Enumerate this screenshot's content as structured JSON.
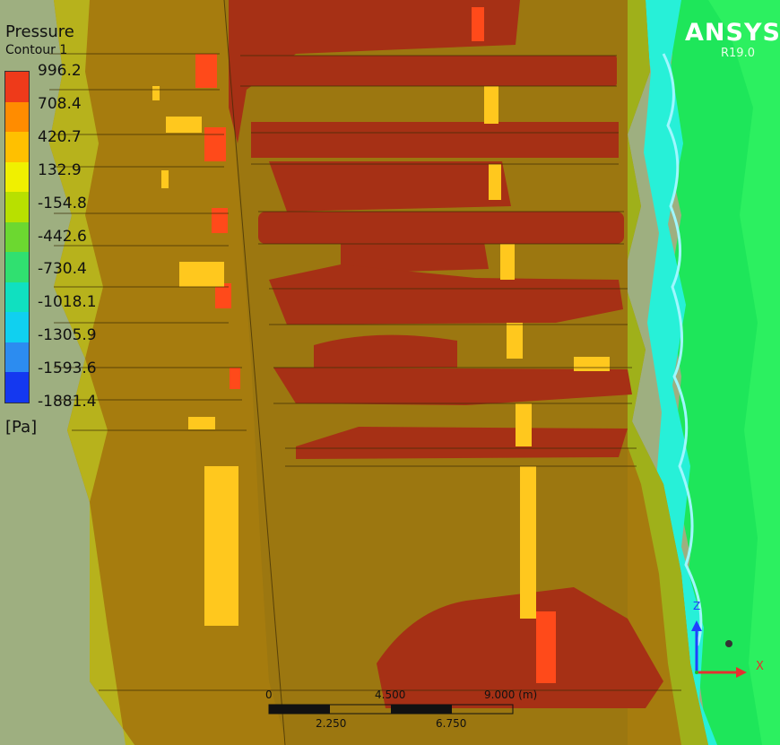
{
  "app": {
    "brand": "ANSYS",
    "version": "R19.0"
  },
  "legend": {
    "title": "Pressure",
    "subtitle": "Contour 1",
    "unit": "[Pa]",
    "levels": [
      "996.2",
      "708.4",
      "420.7",
      "132.9",
      "-154.8",
      "-442.6",
      "-730.4",
      "-1018.1",
      "-1305.9",
      "-1593.6",
      "-1881.4"
    ],
    "colors": [
      "#ee3a1a",
      "#ff8c00",
      "#ffc000",
      "#f0f000",
      "#b8e000",
      "#6cd830",
      "#30e070",
      "#10e0c0",
      "#10d0f0",
      "#2c8cf0",
      "#1438f0"
    ]
  },
  "scale_bar": {
    "top_labels": [
      "0",
      "4.500",
      "9.000 (m)"
    ],
    "bottom_labels": [
      "2.250",
      "6.750"
    ]
  },
  "axes": {
    "x": "X",
    "z": "Z"
  },
  "colors": {
    "background": "#9eaf80",
    "fin_body": "#a67c0e",
    "high_pressure": "#a63015",
    "peak": "#ff4a1a",
    "yellow_edge": "#ffc81e",
    "fluid_green": "#1ee65a",
    "fluid_cyan": "#27f0d8"
  }
}
